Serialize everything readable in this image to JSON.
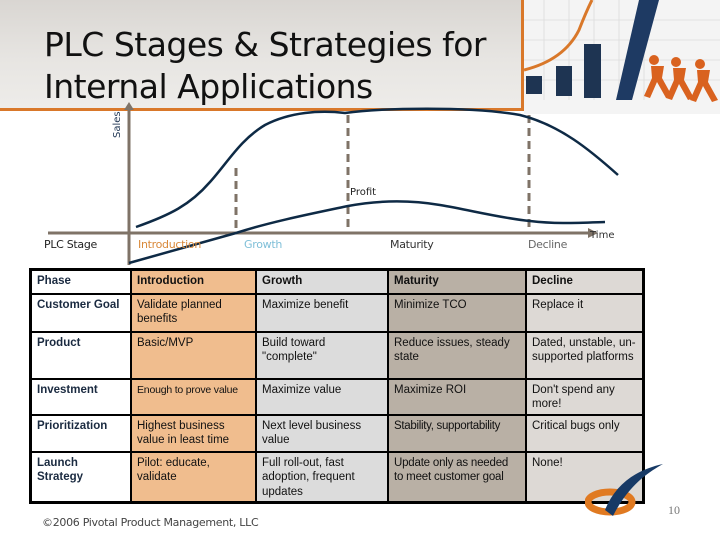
{
  "slide": {
    "title": "PLC Stages & Strategies for\nInternal Applications",
    "page_number": "10",
    "copyright": "©2006 Pivotal Product Management, LLC"
  },
  "diagram": {
    "y_axis_label": "Sales",
    "x_axis_label": "Time",
    "profit_label": "Profit",
    "row_label": "PLC Stage",
    "stages": [
      {
        "name": "Introduction",
        "color": "#d9893a"
      },
      {
        "name": "Growth",
        "color": "#7fbfd8"
      },
      {
        "name": "Maturity",
        "color": "#333333"
      },
      {
        "name": "Decline",
        "color": "#666666"
      }
    ],
    "curves": [
      "Sales",
      "Profit"
    ],
    "colors": {
      "axis": "#7f7367",
      "curve": "#0e2a45",
      "accent": "#d9782a"
    }
  },
  "table": {
    "header": [
      "Phase",
      "Introduction",
      "Growth",
      "Maturity",
      "Decline"
    ],
    "rows": [
      {
        "label": "Customer Goal",
        "cells": [
          "Validate  planned benefits",
          "Maximize benefit",
          "Minimize TCO",
          "Replace it"
        ]
      },
      {
        "label": "Product",
        "cells": [
          "Basic/MVP",
          "Build toward \"complete\"",
          "Reduce issues, steady state",
          "Dated, unstable, un-supported platforms"
        ]
      },
      {
        "label": "Investment",
        "cells": [
          "Enough to prove value",
          "Maximize value",
          "Maximize ROI",
          "Don't spend any more!"
        ]
      },
      {
        "label": "Prioritization",
        "cells": [
          "Highest business value in least time",
          "Next level business value",
          "Stability, supportability",
          "Critical bugs only"
        ]
      },
      {
        "label": "Launch Strategy",
        "cells": [
          "Pilot:  educate, validate",
          "Full roll-out, fast adoption, frequent updates",
          "Update only as needed to meet customer goal",
          "None!"
        ]
      }
    ]
  }
}
